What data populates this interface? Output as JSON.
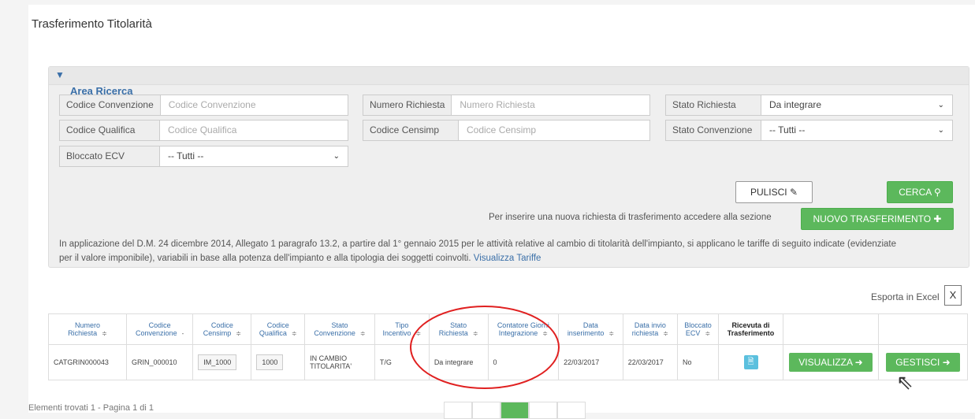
{
  "page_title": "Trasferimento Titolarità",
  "search": {
    "section_title": "Area Ricerca",
    "fields": [
      {
        "label": "Codice Convenzione",
        "placeholder": "Codice Convenzione"
      },
      {
        "label": "Numero Richiesta",
        "placeholder": "Numero Richiesta"
      },
      {
        "label": "Stato Richiesta",
        "value": "Da integrare"
      },
      {
        "label": "Codice Qualifica",
        "placeholder": "Codice Qualifica"
      },
      {
        "label": "Codice Censimp",
        "placeholder": "Codice Censimp"
      },
      {
        "label": "Stato Convenzione",
        "value": "-- Tutti --"
      },
      {
        "label": "Bloccato ECV",
        "value": "-- Tutti --"
      }
    ],
    "reset_label": "PULISCI",
    "search_label": "CERCA",
    "new_transfer_note": "Per inserire una nuova richiesta di trasferimento accedere alla sezione",
    "new_transfer_label": "NUOVO TRASFERIMENTO",
    "tariff_note_line1": "In applicazione del D.M. 24 dicembre 2014, Allegato 1 paragrafo 13.2, a partire dal 1° gennaio 2015 per le attività relative al cambio di titolarità dell'impianto, si applicano le tariffe di seguito indicate (evidenziate",
    "tariff_note_line2": "per il valore imponibile), variabili in base alla potenza dell'impianto e alla tipologia dei soggetti coinvolti.",
    "tariff_link": "Visualizza Tariffe"
  },
  "export_label": "Esporta in Excel",
  "table": {
    "headers": [
      {
        "l1": "Numero",
        "l2": "Richiesta",
        "sort": "≑"
      },
      {
        "l1": "Codice",
        "l2": "Convenzione",
        "sort": "-"
      },
      {
        "l1": "Codice",
        "l2": "Censimp",
        "sort": "≑"
      },
      {
        "l1": "Codice",
        "l2": "Qualifica",
        "sort": "≑"
      },
      {
        "l1": "Stato",
        "l2": "Convenzione",
        "sort": "≑"
      },
      {
        "l1": "Tipo",
        "l2": "Incentivo",
        "sort": "≑"
      },
      {
        "l1": "Stato",
        "l2": "Richiesta",
        "sort": "≑"
      },
      {
        "l1": "Contatore Giorni",
        "l2": "Integrazione",
        "sort": "≑"
      },
      {
        "l1": "Data",
        "l2": "inserimento",
        "sort": "≑"
      },
      {
        "l1": "Data invio",
        "l2": "richiesta",
        "sort": "≑"
      },
      {
        "l1": "Bloccato",
        "l2": "ECV",
        "sort": "≑"
      },
      {
        "l1": "Ricevuta di",
        "l2": "Trasferimento",
        "sort": ""
      }
    ],
    "row": {
      "numero": "CATGRIN000043",
      "convenzione": "GRIN_000010",
      "censimp": "IM_1000",
      "qualifica": "1000",
      "stato_conv_1": "IN CAMBIO",
      "stato_conv_2": "TITOLARITA'",
      "incentivo": "T/G",
      "stato_rich": "Da integrare",
      "contatore": "0",
      "data_ins": "22/03/2017",
      "data_invio": "22/03/2017",
      "bloccato": "No",
      "view_label": "VISUALIZZA",
      "manage_label": "GESTISCI"
    }
  },
  "footer_text": "Elementi trovati 1 - Pagina 1 di 1"
}
